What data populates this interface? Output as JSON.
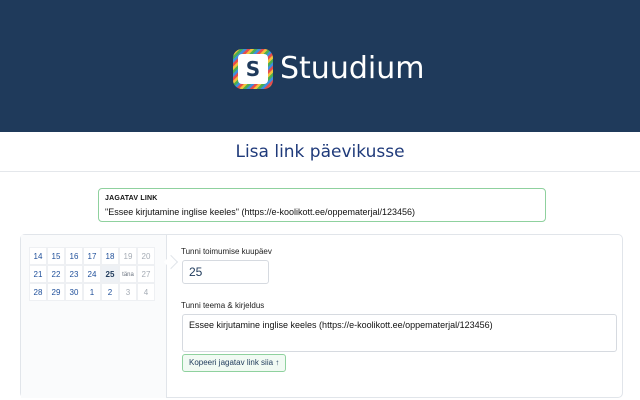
{
  "brand": {
    "logo_letter": "S",
    "name": "Stuudium"
  },
  "page": {
    "title": "Lisa link päevikusse"
  },
  "share_link": {
    "label": "JAGATAV LINK",
    "value": "\"Essee kirjutamine inglise keeles\" (https://e-koolikott.ee/oppematerjal/123456)"
  },
  "calendar": {
    "rows": [
      [
        {
          "d": "14"
        },
        {
          "d": "15"
        },
        {
          "d": "16"
        },
        {
          "d": "17"
        },
        {
          "d": "18"
        },
        {
          "d": "19",
          "muted": true
        },
        {
          "d": "20",
          "muted": true
        }
      ],
      [
        {
          "d": "21"
        },
        {
          "d": "22"
        },
        {
          "d": "23"
        },
        {
          "d": "24"
        },
        {
          "d": "25",
          "bold": true
        },
        {
          "d": "täna",
          "today": true
        },
        {
          "d": "27",
          "muted": true
        }
      ],
      [
        {
          "d": "28"
        },
        {
          "d": "29"
        },
        {
          "d": "30"
        },
        {
          "d": "1"
        },
        {
          "d": "2"
        },
        {
          "d": "3",
          "muted": true
        },
        {
          "d": "4",
          "muted": true
        }
      ]
    ]
  },
  "form": {
    "date_label": "Tunni toimumise kuupäev",
    "date_value": "25",
    "topic_label": "Tunni teema & kirjeldus",
    "topic_value": "Essee kirjutamine inglise keeles (https://e-koolikott.ee/oppematerjal/123456)",
    "copy_button": "Kopeeri jagatav link siia ↑"
  },
  "colors": {
    "header_bg": "#1f3a5b",
    "accent_green": "#8fd19e",
    "title_blue": "#1f3a7a"
  }
}
